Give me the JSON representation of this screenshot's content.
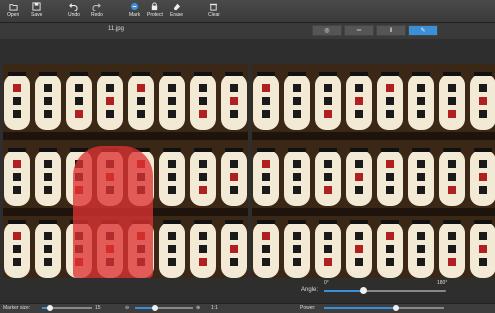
{
  "toolbar": {
    "open": "Open",
    "save": "Save",
    "undo": "Undo",
    "redo": "Redo",
    "mark": "Mark",
    "protect": "Protect",
    "erase": "Erase",
    "clear": "Clear"
  },
  "file": {
    "name": "11.jpg"
  },
  "view_modes": [
    {
      "icon": "target-icon",
      "glyph": "◎",
      "active": false
    },
    {
      "icon": "horizontal-split-icon",
      "glyph": "═",
      "active": false
    },
    {
      "icon": "vertical-split-icon",
      "glyph": "‖",
      "active": false
    },
    {
      "icon": "pencil-icon",
      "glyph": "✎",
      "active": true
    }
  ],
  "angle": {
    "label": "Angle:",
    "min_label": "0°",
    "max_label": "180°",
    "value_fraction": 0.32
  },
  "status": {
    "marker_label": "Marker size:",
    "marker_value": "15",
    "zoom_out": "⊖",
    "zoom_in": "⊕",
    "zoom_ratio": "1:1",
    "power_label": "Power:",
    "marker_fraction": 0.15,
    "zoom_fraction": 0.35,
    "power_fraction": 0.6
  },
  "colors": {
    "accent": "#3b8fd9",
    "mask": "#dc3232",
    "lantern": "#f3ead6",
    "wood": "#3a2716"
  }
}
